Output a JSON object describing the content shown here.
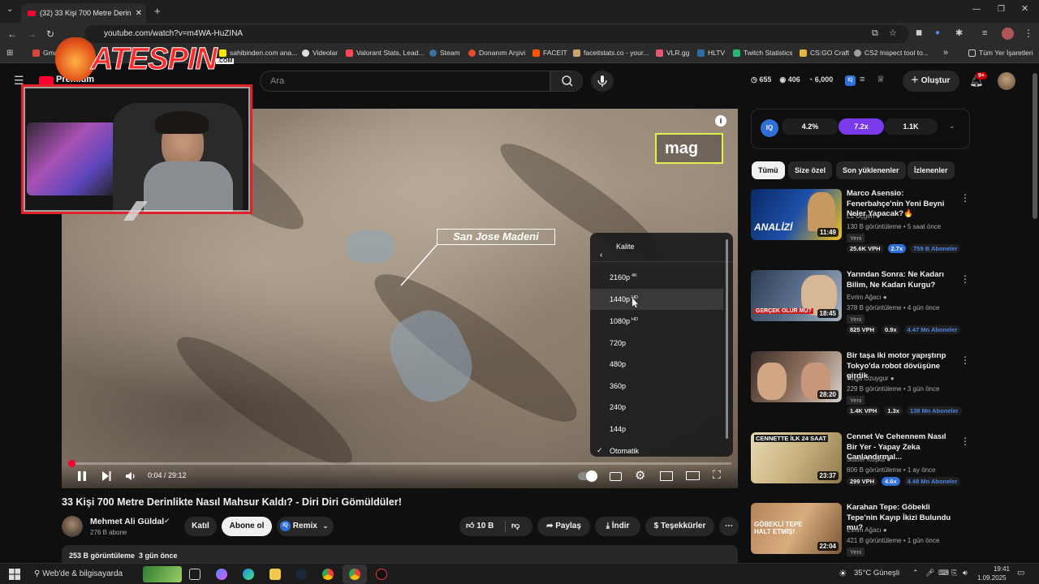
{
  "browser": {
    "tab_title": "(32) 33 Kişi 700 Metre Derin",
    "url": "youtube.com/watch?v=m4WA-HuZINA",
    "bookmarks": [
      "Gmail",
      "Videolar",
      "Valorant Stats, Lead...",
      "Steam",
      "Donanım Arşivi",
      "FACEIT",
      "faceitstats.co - your...",
      "VLR.gg",
      "HLTV",
      "Twitch Statistics",
      "CS:GO Craft",
      "CS2 Inspect tool to..."
    ],
    "sahibinden": "sahibinden.com ana...",
    "all_bookmarks": "Tüm Yer İşaretleri"
  },
  "logo": {
    "text": "ATESPIN",
    "suffix": ".COM"
  },
  "yt": {
    "brand": "Premium",
    "search_placeholder": "Ara",
    "stats": [
      "655",
      "406",
      "6,000"
    ],
    "create": "Oluştur",
    "notif": "9+"
  },
  "video": {
    "label_place": "San Jose Madeni",
    "label_mag": "mag",
    "time": "0:04 / 29:12",
    "title": "33 Kişi 700 Metre Derinlikte Nasıl Mahsur Kaldı? - Diri Diri Gömüldüler!",
    "progress": 0.0023
  },
  "quality_menu": {
    "header": "Kalite",
    "options": [
      {
        "label": "2160p",
        "tag": "4K"
      },
      {
        "label": "1440p",
        "tag": "HD"
      },
      {
        "label": "1080p",
        "tag": "HD"
      },
      {
        "label": "720p",
        "tag": ""
      },
      {
        "label": "480p",
        "tag": ""
      },
      {
        "label": "360p",
        "tag": ""
      },
      {
        "label": "240p",
        "tag": ""
      },
      {
        "label": "144p",
        "tag": ""
      }
    ],
    "selected": "Otomatik"
  },
  "channel": {
    "name": "Mehmet Ali Güldal",
    "subs": "276 B abone",
    "join": "Katıl",
    "subscribe": "Abone ol",
    "remix": "Remix",
    "likes": "10 B",
    "share": "Paylaş",
    "download": "İndir",
    "thanks": "Teşekkürler"
  },
  "description": {
    "views": "253 B görüntüleme",
    "date": "3 gün önce"
  },
  "side_stats": [
    "4.2%",
    "7.2x",
    "1.1K"
  ],
  "chips": [
    "Tümü",
    "Size özel",
    "Son yüklenenler",
    "İzlenenler"
  ],
  "recommendations": [
    {
      "title": "Marco  Asensio: Fenerbahçe'nin Yeni Beyni Neler Yapacak?🔥",
      "channel": "L1 Üçgen",
      "meta": "130 B görüntüleme • 5 saat önce",
      "badge": "Yeni",
      "vph": "25.6K VPH",
      "mult": "2.7x",
      "subs": "759 B Aboneler",
      "dur": "11:49",
      "thumb_text": "ANALİZİ"
    },
    {
      "title": "Yarından Sonra: Ne Kadarı Bilim, Ne Kadarı Kurgu?",
      "channel": "Evrim Ağacı",
      "meta": "378 B görüntüleme • 4 gün önce",
      "badge": "Yeni",
      "vph": "825 VPH",
      "mult": "0.9x",
      "subs": "4.47 Mn Aboneler",
      "dur": "18:45",
      "thumb_text": "GERÇEK OLUR MU?"
    },
    {
      "title": "Bir taşa iki motor yapıştırıp Tokyo'da robot dövüşüne girdik",
      "channel": "Tolga Özuygur",
      "meta": "229 B görüntüleme • 3 gün önce",
      "badge": "Yeni",
      "vph": "1.4K VPH",
      "mult": "1.3x",
      "subs": "138 Mn Aboneler",
      "dur": "28:20",
      "thumb_text": ""
    },
    {
      "title": "Cennet Ve Cehennem Nasıl Bir Yer - Yapay Zeka Canlandırmal...",
      "channel": "Sözler Köşkü",
      "meta": "806 B görüntüleme • 1 ay önce",
      "badge": "",
      "vph": "299 VPH",
      "mult": "4.6x",
      "subs": "4.48 Mn Aboneler",
      "dur": "23:37",
      "thumb_text": "CENNETTE İLK 24 SAAT"
    },
    {
      "title": "Karahan Tepe: Göbekli Tepe'nin Kayıp İkizi Bulundu mu?",
      "channel": "Evrim Ağacı",
      "meta": "421 B görüntüleme • 1 gün önce",
      "badge": "Yeni",
      "vph": "",
      "mult": "",
      "subs": "",
      "dur": "22:04",
      "thumb_text": "GÖBEKLİ TEPE HALT ETMİŞ!"
    }
  ],
  "taskbar": {
    "search": "Web'de & bilgisayarda",
    "weather": "35°C  Güneşli",
    "time": "19:41",
    "date": "1.09.2025"
  }
}
